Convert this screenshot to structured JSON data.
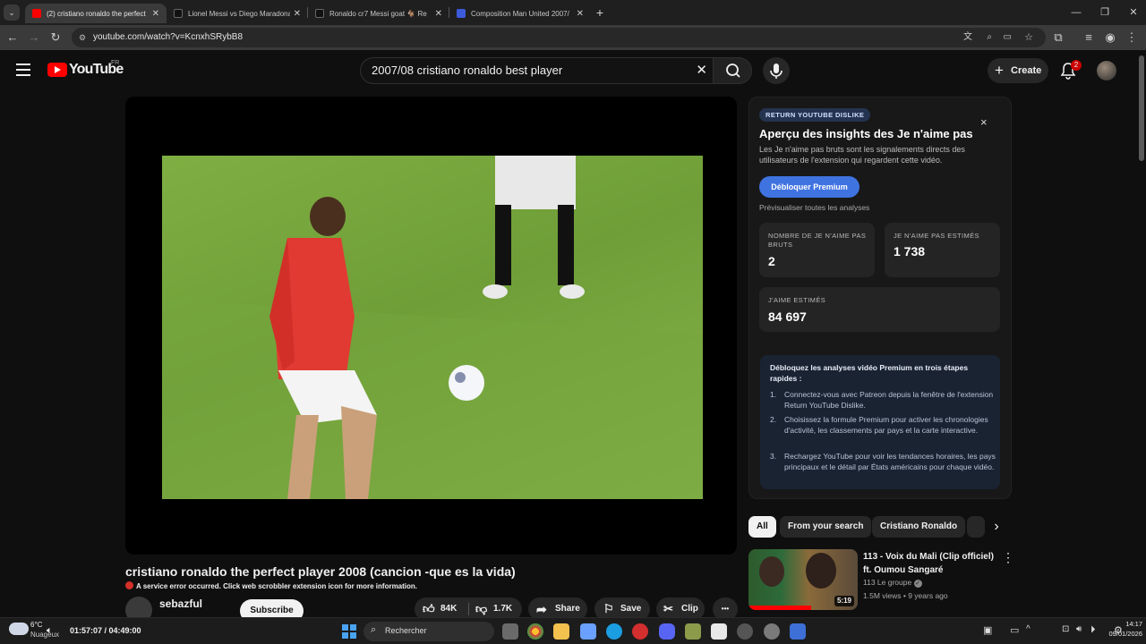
{
  "browser": {
    "tabs": [
      {
        "title": "(2) cristiano ronaldo the perfect",
        "favicon_color": "#ff0000",
        "active": true
      },
      {
        "title": "Lionel Messi vs Diego Maradona",
        "favicon_color": "#111111",
        "active": false
      },
      {
        "title": "Ronaldo cr7 Messi goat 🐐 Re",
        "favicon_color": "#111111",
        "active": false
      },
      {
        "title": "Composition Man United 2007/",
        "favicon_color": "#3b5bdb",
        "active": false
      }
    ],
    "new_tab": "+",
    "url": "youtube.com/watch?v=KcnxhSRybB8"
  },
  "youtube": {
    "logo_text": "YouTube",
    "region": "FR",
    "search_query": "2007/08 cristiano ronaldo best player",
    "create_label": "Create",
    "notification_count": "2"
  },
  "video": {
    "title": "cristiano ronaldo the perfect player 2008 (cancion -que es la vida)",
    "error_text": "A service error occurred. Click web scrobbler extension icon for more information.",
    "channel": "sebazful",
    "subscribe_label": "Subscribe",
    "likes": "84K",
    "dislikes": "1.7K",
    "share_label": "Share",
    "save_label": "Save",
    "clip_label": "Clip",
    "more_label": "•••"
  },
  "ryd": {
    "badge": "RETURN YOUTUBE DISLIKE",
    "heading": "Aperçu des insights des Je n'aime pas",
    "description": "Les Je n'aime pas bruts sont les signalements directs des utilisateurs de l'extension qui regardent cette vidéo.",
    "unlock_button": "Débloquer Premium",
    "preview_link": "Prévisualiser toutes les analyses",
    "stats": [
      {
        "label": "NOMBRE DE JE N'AIME PAS BRUTS",
        "value": "2"
      },
      {
        "label": "JE N'AIME PAS ESTIMÉS",
        "value": "1 738"
      },
      {
        "label": "J'AIME ESTIMÉS",
        "value": "84 697"
      }
    ],
    "steps_heading": "Débloquez les analyses vidéo Premium en trois étapes rapides :",
    "steps": [
      "Connectez-vous avec Patreon depuis la fenêtre de l'extension Return YouTube Dislike.",
      "Choisissez la formule Premium pour activer les chronologies d'activité, les classements par pays et la carte interactive.",
      "Rechargez YouTube pour voir les tendances horaires, les pays principaux et le détail par États américains pour chaque vidéo."
    ],
    "close": "×"
  },
  "chips": [
    "All",
    "From your search",
    "Cristiano Ronaldo"
  ],
  "recommended": [
    {
      "title": "113 - Voix du Mali (Clip officiel) ft. Oumou Sangaré",
      "channel": "113 Le groupe",
      "meta": "1.5M views • 9 years ago",
      "duration": "5:19"
    }
  ],
  "taskbar": {
    "weather_temp": "6°C",
    "weather_desc": "Nuageux",
    "media_time": "01:57:07 / 04:49:00",
    "search_placeholder": "Rechercher",
    "clock_time": "14:17",
    "clock_date": "09/01/2026"
  }
}
